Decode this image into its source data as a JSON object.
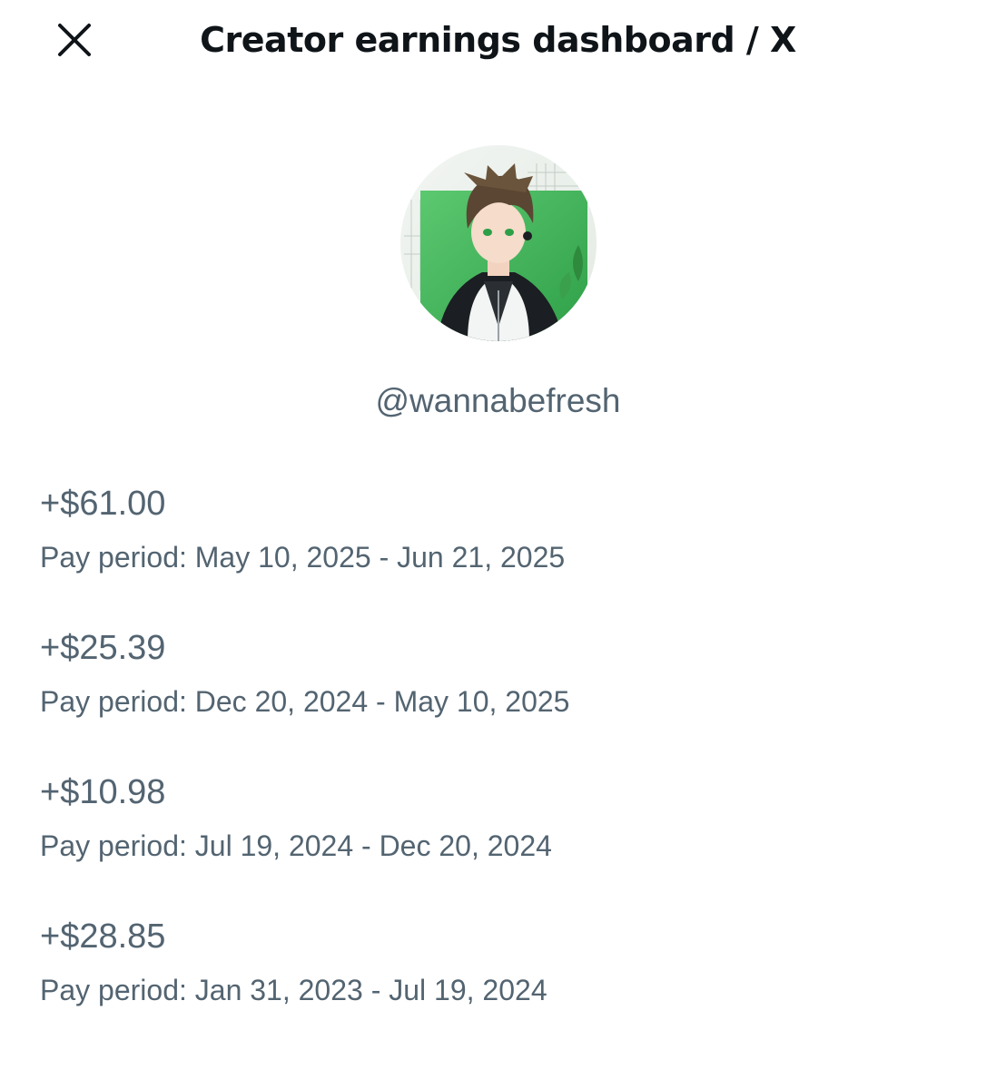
{
  "header": {
    "title": "Creator earnings dashboard / X",
    "close_icon": "close-icon"
  },
  "profile": {
    "handle": "@wannabefresh",
    "avatar_icon": "avatar-illustration",
    "accent_color": "#3fb45a"
  },
  "earnings": [
    {
      "amount": "+$61.00",
      "period": "Pay period: May 10, 2025 - Jun 21, 2025"
    },
    {
      "amount": "+$25.39",
      "period": "Pay period: Dec 20, 2024 - May 10, 2025"
    },
    {
      "amount": "+$10.98",
      "period": "Pay period: Jul 19, 2024 - Dec 20, 2024"
    },
    {
      "amount": "+$28.85",
      "period": "Pay period: Jan 31, 2023 - Jul 19, 2024"
    }
  ]
}
